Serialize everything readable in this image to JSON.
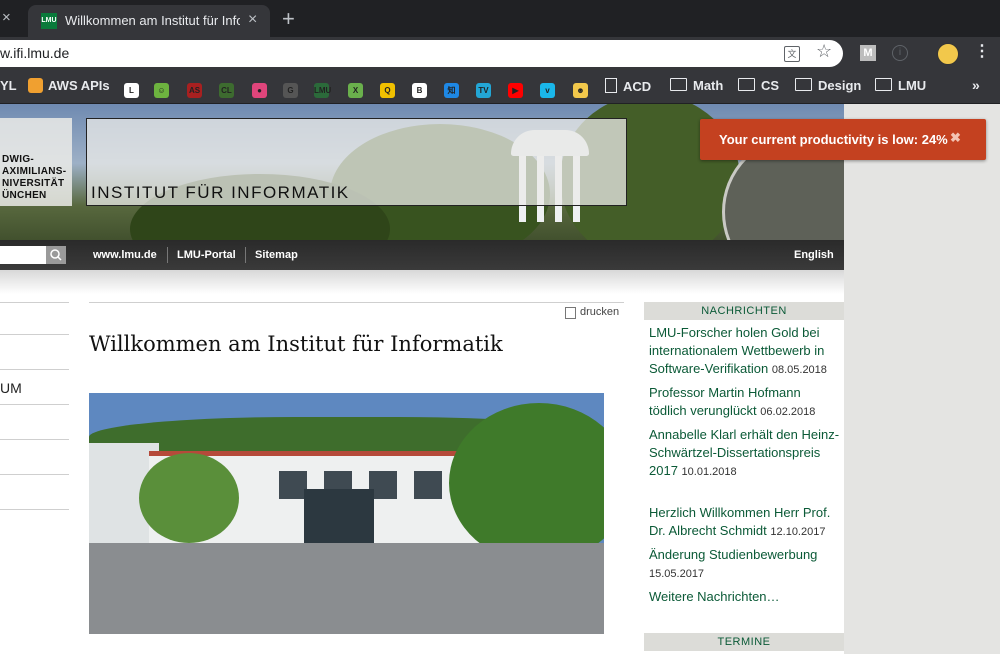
{
  "browser": {
    "tab": {
      "favicon": "LMU",
      "title": "Willkommen am Institut für Informatik",
      "close": "×"
    },
    "tab_left_close": "×",
    "new_tab": "+",
    "url": "w.ifi.lmu.de",
    "icons": {
      "translate": "translate-icon",
      "star": "☆",
      "ext_m": "M",
      "ext_info": "i",
      "menu": "⋮"
    },
    "bookmarks": [
      {
        "label": "YL",
        "icon": ""
      },
      {
        "label": "AWS APIs",
        "icon": "aws-icon",
        "color": "#f0a030"
      },
      {
        "label": "",
        "icon": "L",
        "color": "#ffffff"
      },
      {
        "label": "",
        "icon": "☺",
        "color": "#6db33f"
      },
      {
        "label": "",
        "icon": "AS",
        "color": "#a82020"
      },
      {
        "label": "",
        "icon": "CL",
        "color": "#3d6b2f"
      },
      {
        "label": "",
        "icon": "●",
        "color": "#e0457b"
      },
      {
        "label": "",
        "icon": "G",
        "color": "#555555"
      },
      {
        "label": "",
        "icon": "LMU",
        "color": "#2b6a3a"
      },
      {
        "label": "",
        "icon": "X",
        "color": "#6ab04c"
      },
      {
        "label": "",
        "icon": "Q",
        "color": "#f0c000"
      },
      {
        "label": "",
        "icon": "B",
        "color": "#ffffff"
      },
      {
        "label": "",
        "icon": "知",
        "color": "#1e88e5"
      },
      {
        "label": "",
        "icon": "TV",
        "color": "#23a6d5"
      },
      {
        "label": "",
        "icon": "▶",
        "color": "#ff0000"
      },
      {
        "label": "",
        "icon": "v",
        "color": "#1ab7ea"
      },
      {
        "label": "",
        "icon": "☻",
        "color": "#f2c84b"
      },
      {
        "label": "ACD",
        "icon": "doc"
      },
      {
        "label": "Math",
        "icon": "folder"
      },
      {
        "label": "CS",
        "icon": "folder"
      },
      {
        "label": "Design",
        "icon": "folder"
      },
      {
        "label": "LMU",
        "icon": "folder"
      }
    ],
    "bookmarks_more": "»"
  },
  "header": {
    "logo_lines": [
      "DWIG-",
      "AXIMILIANS-",
      "NIVERSITÄT",
      "ÜNCHEN"
    ],
    "institute_title": "INSTITUT FÜR INFORMATIK",
    "nav": [
      "www.lmu.de",
      "LMU-Portal",
      "Sitemap"
    ],
    "lang": "English"
  },
  "leftnav": {
    "item": "UM"
  },
  "main": {
    "print": "drucken",
    "title": "Willkommen am Institut für Informatik"
  },
  "sidebar": {
    "news_heading": "NACHRICHTEN",
    "news": [
      {
        "text": "LMU-Forscher holen Gold bei internationalem Wettbewerb in Software-Verifikation",
        "date": "08.05.2018"
      },
      {
        "text": "Professor Martin Hofmann tödlich verunglückt",
        "date": "06.02.2018"
      },
      {
        "text": "Annabelle Klarl erhält den Heinz-Schwärtzel-Dissertationspreis 2017",
        "date": "10.01.2018"
      },
      {
        "text": "Herzlich Willkommen Herr Prof. Dr. Albrecht Schmidt",
        "date": "12.10.2017"
      },
      {
        "text": "Änderung Studienbewerbung",
        "date": "15.05.2017"
      }
    ],
    "more_news": "Weitere Nachrichten…",
    "termine_heading": "TERMINE"
  },
  "toast": {
    "text": "Your current productivity is low: 24%",
    "close": "✖",
    "value": 24
  }
}
